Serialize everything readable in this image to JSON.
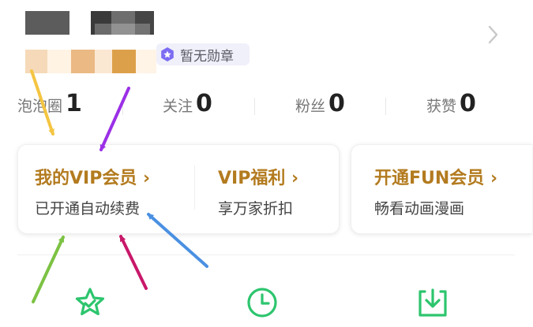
{
  "profile": {
    "medal_badge": "暂无勋章"
  },
  "stats": [
    {
      "label": "泡泡圈",
      "value": "1"
    },
    {
      "label": "关注",
      "value": "0"
    },
    {
      "label": "粉丝",
      "value": "0"
    },
    {
      "label": "获赞",
      "value": "0"
    }
  ],
  "vip": {
    "my_vip_title": "我的VIP会员 ›",
    "my_vip_sub": "已开通自动续费",
    "welfare_title": "VIP福利 ›",
    "welfare_sub": "享万家折扣",
    "fun_title": "开通FUN会员 ›",
    "fun_sub": "畅看动画漫画"
  },
  "colors": {
    "gold": "#b37b1f",
    "arrow_yellow": "#f4c542",
    "arrow_purple": "#9b30e6",
    "arrow_green": "#7cc243",
    "arrow_crimson": "#c8186a",
    "arrow_blue": "#4a90e2",
    "icon_green": "#2dc56e"
  },
  "bottom_icons": [
    "star-icon",
    "clock-icon",
    "download-icon"
  ]
}
